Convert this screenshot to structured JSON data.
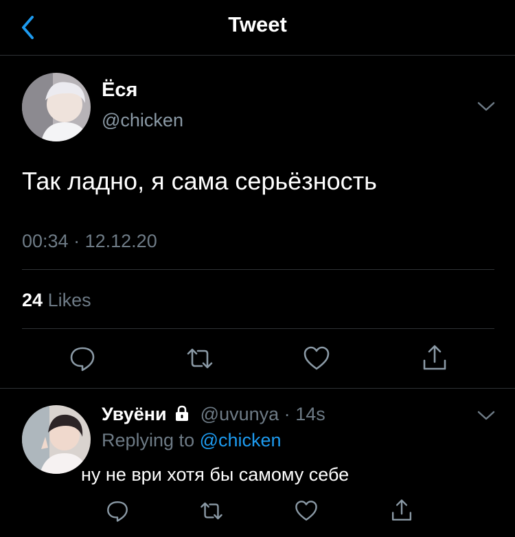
{
  "nav": {
    "title": "Tweet"
  },
  "tweet": {
    "name": "Ёся",
    "handle": "@chicken",
    "text": "Так ладно, я сама серьёзность",
    "time": "00:34",
    "separator": "·",
    "date": "12.12.20",
    "likes_count": "24",
    "likes_label": "Likes"
  },
  "reply": {
    "name": "Увуёни",
    "handle": "@uvunya",
    "separator": "·",
    "age": "14s",
    "replying_to_label": "Replying to",
    "replying_to_handle": "@chicken",
    "text": "ну не ври хотя бы самому себе"
  },
  "icons": {
    "back": "chevron-left-icon",
    "more": "chevron-down-icon",
    "reply": "comment-icon",
    "retweet": "retweet-icon",
    "like": "heart-icon",
    "share": "share-icon",
    "protected": "lock-icon"
  },
  "colors": {
    "background": "#000000",
    "accent": "#1d9bf0",
    "secondary_text": "#6e7b86",
    "divider": "#2f3336"
  }
}
